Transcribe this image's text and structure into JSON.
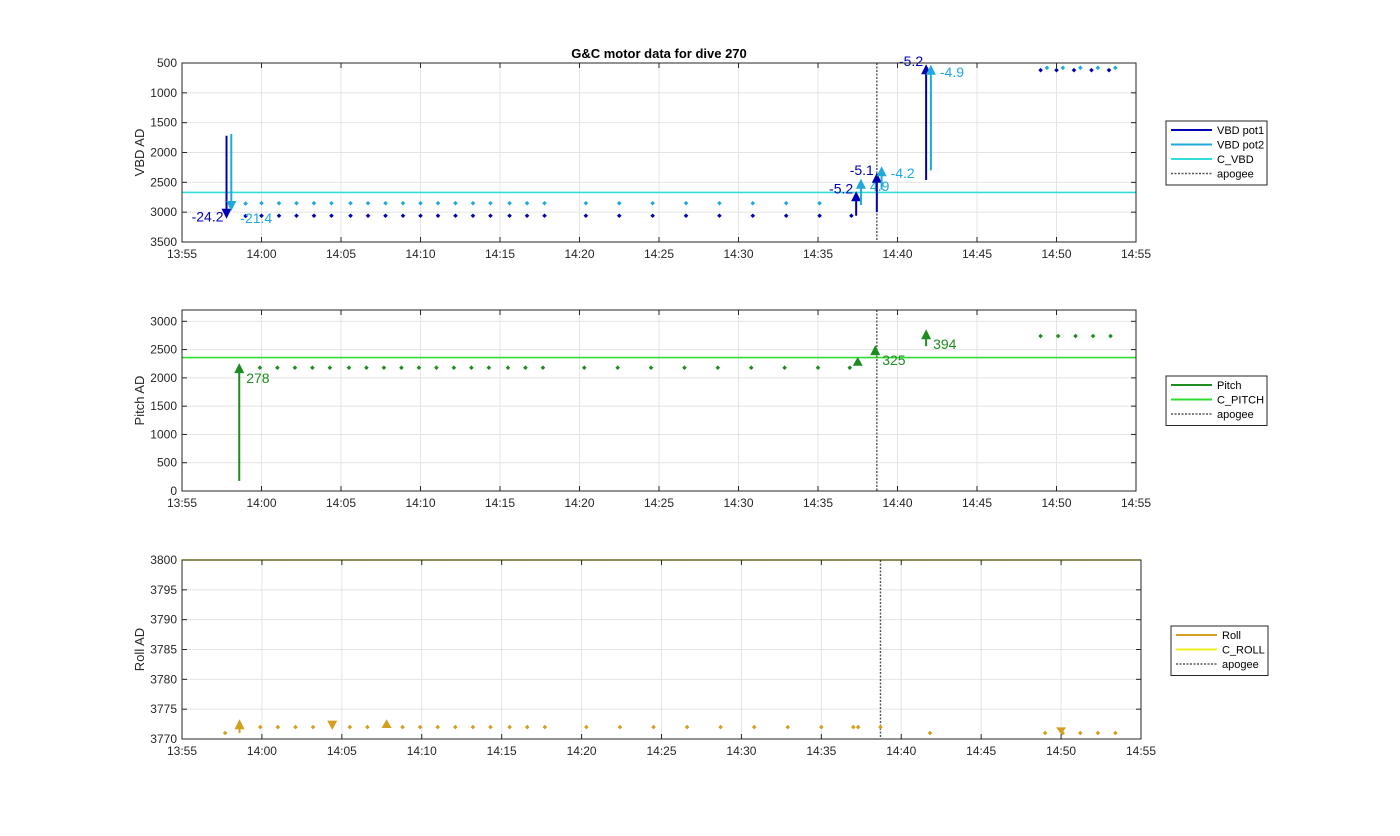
{
  "chart_data": [
    {
      "type": "scatter",
      "title": "G&C motor data for dive 270",
      "ylabel": "VBD AD",
      "ylim": [
        500,
        3500
      ],
      "y_reversed": true,
      "xlim": [
        "13:55",
        "14:55"
      ],
      "x_ticks": [
        "13:55",
        "14:00",
        "14:05",
        "14:10",
        "14:15",
        "14:20",
        "14:25",
        "14:30",
        "14:35",
        "14:40",
        "14:45",
        "14:50",
        "14:55"
      ],
      "y_ticks": [
        500,
        1000,
        1500,
        2000,
        2500,
        3000,
        3500
      ],
      "grid": true,
      "legend_position": "right",
      "legend": [
        "VBD pot1",
        "VBD pot2",
        "C_VBD",
        "apogee"
      ],
      "colors": {
        "pot1": "#0000b4",
        "pot2": "#1eaadc",
        "c_line": "#32dcdc",
        "apogee": "#555555"
      },
      "c_value": 2670,
      "apogee_time": "14:38.7",
      "series": [
        {
          "name": "VBD pot1",
          "x": [
            "13:59.0",
            "14:00.0",
            "14:01.1",
            "14:02.2",
            "14:03.3",
            "14:04.4",
            "14:05.6",
            "14:06.7",
            "14:07.8",
            "14:08.9",
            "14:10.0",
            "14:11.1",
            "14:12.2",
            "14:13.3",
            "14:14.4",
            "14:15.6",
            "14:16.7",
            "14:17.8",
            "14:20.4",
            "14:22.5",
            "14:24.6",
            "14:26.7",
            "14:28.8",
            "14:30.9",
            "14:33.0",
            "14:35.1",
            "14:37.1",
            "14:49.0",
            "14:50.0",
            "14:51.1",
            "14:52.2",
            "14:53.3"
          ],
          "y": [
            3065,
            3060,
            3060,
            3060,
            3060,
            3060,
            3060,
            3060,
            3060,
            3060,
            3060,
            3060,
            3060,
            3060,
            3060,
            3060,
            3060,
            3060,
            3060,
            3060,
            3060,
            3060,
            3060,
            3060,
            3060,
            3060,
            3060,
            620,
            620,
            620,
            620,
            620
          ]
        },
        {
          "name": "VBD pot2",
          "x": [
            "13:59.0",
            "14:00.0",
            "14:01.1",
            "14:02.2",
            "14:03.3",
            "14:04.4",
            "14:05.6",
            "14:06.7",
            "14:07.8",
            "14:08.9",
            "14:10.0",
            "14:11.1",
            "14:12.2",
            "14:13.3",
            "14:14.4",
            "14:15.6",
            "14:16.7",
            "14:17.8",
            "14:20.4",
            "14:22.5",
            "14:24.6",
            "14:26.7",
            "14:28.8",
            "14:30.9",
            "14:33.0",
            "14:35.1",
            "14:49.4",
            "14:50.4",
            "14:51.5",
            "14:52.6",
            "14:53.7"
          ],
          "y": [
            2855,
            2850,
            2850,
            2850,
            2850,
            2850,
            2850,
            2850,
            2850,
            2850,
            2850,
            2850,
            2850,
            2850,
            2850,
            2850,
            2850,
            2850,
            2850,
            2850,
            2850,
            2850,
            2850,
            2850,
            2850,
            2850,
            580,
            580,
            580,
            580,
            580
          ]
        }
      ],
      "moves": [
        {
          "series": "VBD pot1",
          "x": "13:57.8",
          "y0": 1720,
          "y1": 3110,
          "label": "-24.2"
        },
        {
          "series": "VBD pot2",
          "x": "13:58.1",
          "y0": 1690,
          "y1": 2980,
          "label": "-21.4"
        },
        {
          "series": "VBD pot1",
          "x": "14:37.4",
          "y0": 3060,
          "y1": 2650,
          "label": "-5.2"
        },
        {
          "series": "VBD pot2",
          "x": "14:37.7",
          "y0": 2880,
          "y1": 2440,
          "label": "4.9"
        },
        {
          "series": "VBD pot1",
          "x": "14:38.7",
          "y0": 3000,
          "y1": 2340,
          "label": "-5.1"
        },
        {
          "series": "VBD pot2",
          "x": "14:39.0",
          "y0": 2620,
          "y1": 2230,
          "label": "-4.2"
        },
        {
          "series": "VBD pot1",
          "x": "14:41.8",
          "y0": 2460,
          "y1": 520,
          "label": "-5.2"
        },
        {
          "series": "VBD pot2",
          "x": "14:42.1",
          "y0": 2300,
          "y1": 530,
          "label": "-4.9"
        }
      ]
    },
    {
      "type": "scatter",
      "ylabel": "Pitch AD",
      "ylim": [
        0,
        3200
      ],
      "xlim": [
        "13:55",
        "14:55"
      ],
      "x_ticks": [
        "13:55",
        "14:00",
        "14:05",
        "14:10",
        "14:15",
        "14:20",
        "14:25",
        "14:30",
        "14:35",
        "14:40",
        "14:45",
        "14:50",
        "14:55"
      ],
      "y_ticks": [
        0,
        500,
        1000,
        1500,
        2000,
        2500,
        3000
      ],
      "grid": true,
      "legend_position": "right",
      "legend": [
        "Pitch",
        "C_PITCH",
        "apogee"
      ],
      "colors": {
        "pitch": "#1e8c1e",
        "c_line": "#32dc32",
        "apogee": "#555555"
      },
      "c_value": 2360,
      "apogee_time": "14:38.7",
      "series": [
        {
          "name": "Pitch",
          "x": [
            "13:59.9",
            "14:01.0",
            "14:02.1",
            "14:03.2",
            "14:04.3",
            "14:05.5",
            "14:06.6",
            "14:07.7",
            "14:08.8",
            "14:09.9",
            "14:11.0",
            "14:12.1",
            "14:13.2",
            "14:14.3",
            "14:15.5",
            "14:16.6",
            "14:17.7",
            "14:20.3",
            "14:22.4",
            "14:24.5",
            "14:26.6",
            "14:28.7",
            "14:30.8",
            "14:32.9",
            "14:35.0",
            "14:37.0",
            "14:49.0",
            "14:50.1",
            "14:51.2",
            "14:52.3",
            "14:53.4"
          ],
          "y": [
            2180,
            2180,
            2180,
            2180,
            2180,
            2180,
            2180,
            2180,
            2180,
            2180,
            2180,
            2180,
            2180,
            2180,
            2180,
            2180,
            2180,
            2180,
            2180,
            2180,
            2180,
            2180,
            2180,
            2180,
            2180,
            2180,
            2740,
            2740,
            2740,
            2740,
            2740
          ]
        }
      ],
      "moves": [
        {
          "series": "Pitch",
          "x": "13:58.6",
          "y0": 180,
          "y1": 2260,
          "label": "278"
        },
        {
          "series": "Pitch",
          "x": "14:37.5",
          "y0": 2230,
          "y1": 2370,
          "label": ""
        },
        {
          "series": "Pitch",
          "x": "14:38.6",
          "y0": 2400,
          "y1": 2580,
          "label": "325"
        },
        {
          "series": "Pitch",
          "x": "14:41.8",
          "y0": 2560,
          "y1": 2860,
          "label": "394"
        }
      ]
    },
    {
      "type": "scatter",
      "ylabel": "Roll AD",
      "ylim": [
        3770,
        3800
      ],
      "xlim": [
        "13:55",
        "14:55"
      ],
      "x_ticks": [
        "13:55",
        "14:00",
        "14:05",
        "14:10",
        "14:15",
        "14:20",
        "14:25",
        "14:30",
        "14:35",
        "14:40",
        "14:45",
        "14:50",
        "14:55"
      ],
      "y_ticks": [
        3770,
        3775,
        3780,
        3785,
        3790,
        3795,
        3800
      ],
      "grid": true,
      "legend_position": "right",
      "legend": [
        "Roll",
        "C_ROLL",
        "apogee"
      ],
      "colors": {
        "roll": "#d2a01e",
        "c_line": "#f0f01e",
        "apogee": "#555555"
      },
      "c_value": 3800,
      "apogee_time": "14:38.7",
      "series": [
        {
          "name": "Roll",
          "x": [
            "13:57.7",
            "13:59.9",
            "14:01.0",
            "14:02.1",
            "14:03.2",
            "14:05.5",
            "14:06.6",
            "14:08.8",
            "14:09.9",
            "14:11.0",
            "14:12.1",
            "14:13.2",
            "14:14.3",
            "14:15.5",
            "14:16.6",
            "14:17.7",
            "14:20.3",
            "14:22.4",
            "14:24.5",
            "14:26.6",
            "14:28.7",
            "14:30.8",
            "14:32.9",
            "14:35.0",
            "14:37.0",
            "14:37.3",
            "14:38.7",
            "14:41.8",
            "14:49.0",
            "14:50.1",
            "14:51.2",
            "14:52.3",
            "14:53.4"
          ],
          "y": [
            3771,
            3772,
            3772,
            3772,
            3772,
            3772,
            3772,
            3772,
            3772,
            3772,
            3772,
            3772,
            3772,
            3772,
            3772,
            3772,
            3772,
            3772,
            3772,
            3772,
            3772,
            3772,
            3772,
            3772,
            3772,
            3772,
            3772,
            3771,
            3771,
            3771,
            3771,
            3771,
            3771
          ]
        }
      ],
      "moves": [
        {
          "series": "Roll",
          "x": "13:58.6",
          "y0": 3771,
          "y1": 3773.3,
          "label": ""
        },
        {
          "series": "Roll",
          "x": "14:04.4",
          "y0": 3773,
          "y1": 3771.5,
          "label": ""
        },
        {
          "series": "Roll",
          "x": "14:07.8",
          "y0": 3772,
          "y1": 3773.3,
          "label": ""
        },
        {
          "series": "Roll",
          "x": "14:50.0",
          "y0": 3771.6,
          "y1": 3770.8,
          "label": ""
        }
      ]
    }
  ]
}
